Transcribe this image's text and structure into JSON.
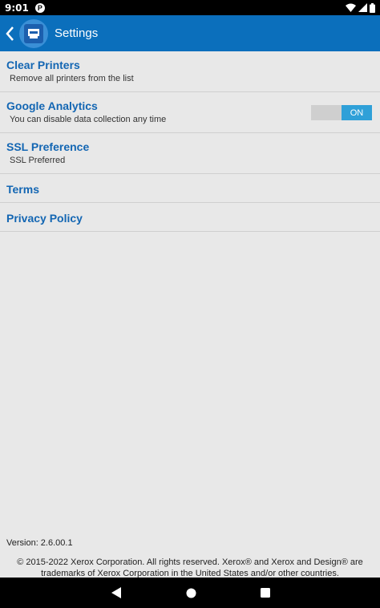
{
  "status_bar": {
    "time": "9:01",
    "notification": "P"
  },
  "app_bar": {
    "title": "Settings"
  },
  "settings": {
    "clear_printers": {
      "title": "Clear Printers",
      "subtitle": "Remove all printers from the list"
    },
    "google_analytics": {
      "title": "Google Analytics",
      "subtitle": "You can disable data collection any time",
      "toggle_label": "ON"
    },
    "ssl_preference": {
      "title": "SSL Preference",
      "subtitle": "SSL Preferred"
    },
    "terms": {
      "title": "Terms"
    },
    "privacy_policy": {
      "title": "Privacy Policy"
    }
  },
  "footer": {
    "version": "Version: 2.6.00.1",
    "copyright": "© 2015-2022 Xerox Corporation. All rights reserved. Xerox® and Xerox and Design® are trademarks of Xerox Corporation in the United States and/or other countries."
  },
  "colors": {
    "app_bar": "#0b6fbc",
    "accent_text": "#1366b3",
    "toggle_on": "#2fa0d8",
    "background": "#e8e8e8"
  }
}
